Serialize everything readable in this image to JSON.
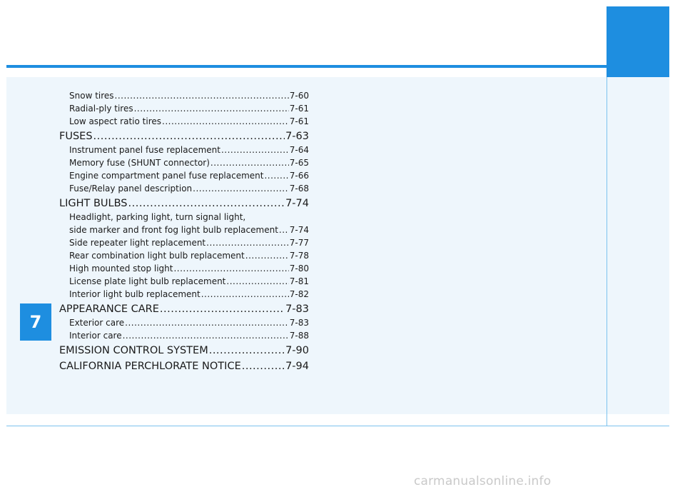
{
  "chapter": {
    "number": "7"
  },
  "toc": {
    "entries": [
      {
        "level": "sub",
        "title": "Snow tires",
        "page": "7-60"
      },
      {
        "level": "sub",
        "title": "Radial-ply tires",
        "page": "7-61"
      },
      {
        "level": "sub",
        "title": "Low aspect ratio tires",
        "page": "7-61"
      },
      {
        "level": "main",
        "title": "FUSES",
        "page": "7-63"
      },
      {
        "level": "sub",
        "title": "Instrument panel fuse replacement",
        "page": "7-64"
      },
      {
        "level": "sub",
        "title": "Memory fuse (SHUNT connector)",
        "page": "7-65"
      },
      {
        "level": "sub",
        "title": "Engine compartment panel fuse replacement",
        "page": "7-66"
      },
      {
        "level": "sub",
        "title": "Fuse/Relay panel description",
        "page": "7-68"
      },
      {
        "level": "main",
        "title": "LIGHT BULBS",
        "page": "7-74"
      },
      {
        "level": "cont",
        "title": "Headlight, parking light, turn signal light,",
        "page": ""
      },
      {
        "level": "sub",
        "title": "side marker and front fog light bulb replacement",
        "page": "7-74"
      },
      {
        "level": "sub",
        "title": "Side repeater light replacement",
        "page": "7-77"
      },
      {
        "level": "sub",
        "title": "Rear combination light bulb replacement",
        "page": "7-78"
      },
      {
        "level": "sub",
        "title": "High mounted stop light",
        "page": "7-80"
      },
      {
        "level": "sub",
        "title": "License plate light bulb replacement",
        "page": "7-81"
      },
      {
        "level": "sub",
        "title": "Interior light bulb replacement",
        "page": "7-82"
      },
      {
        "level": "main",
        "title": "APPEARANCE CARE",
        "page": "7-83"
      },
      {
        "level": "sub",
        "title": "Exterior care",
        "page": "7-83"
      },
      {
        "level": "sub",
        "title": "Interior care",
        "page": "7-88"
      },
      {
        "level": "main",
        "title": "EMISSION CONTROL SYSTEM",
        "page": "7-90"
      },
      {
        "level": "main",
        "title": "CALIFORNIA PERCHLORATE NOTICE",
        "page": "7-94"
      }
    ]
  },
  "watermark": {
    "text": "carmanualsonline.info"
  },
  "colors": {
    "accent": "#1e8ee0",
    "panel": "#eef6fc",
    "rule": "#7cc2ee"
  }
}
